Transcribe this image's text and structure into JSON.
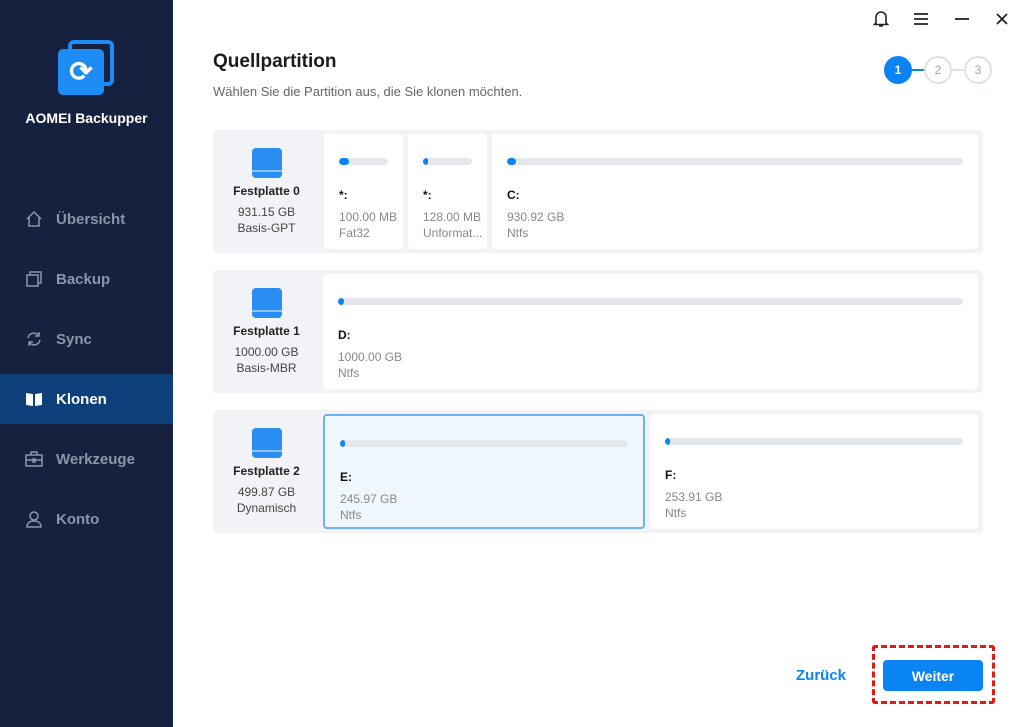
{
  "app": {
    "name": "AOMEI Backupper"
  },
  "nav": [
    {
      "label": "Übersicht",
      "icon": "home-icon"
    },
    {
      "label": "Backup",
      "icon": "backup-icon"
    },
    {
      "label": "Sync",
      "icon": "sync-icon"
    },
    {
      "label": "Klonen",
      "icon": "clone-icon",
      "active": true
    },
    {
      "label": "Werkzeuge",
      "icon": "toolbox-icon"
    },
    {
      "label": "Konto",
      "icon": "user-icon"
    }
  ],
  "page": {
    "title": "Quellpartition",
    "subtitle": "Wählen Sie die Partition aus, die Sie klonen möchten."
  },
  "steps": [
    "1",
    "2",
    "3"
  ],
  "disks": [
    {
      "name": "Festplatte 0",
      "size": "931.15 GB",
      "type": "Basis-GPT",
      "partitions": [
        {
          "label": "*:",
          "size": "100.00 MB",
          "fs": "Fat32",
          "used": 0.2
        },
        {
          "label": "*:",
          "size": "128.00 MB",
          "fs": "Unformat...",
          "used": 0.05
        },
        {
          "label": "C:",
          "size": "930.92 GB",
          "fs": "Ntfs",
          "used": 0.02
        }
      ]
    },
    {
      "name": "Festplatte 1",
      "size": "1000.00 GB",
      "type": "Basis-MBR",
      "partitions": [
        {
          "label": "D:",
          "size": "1000.00 GB",
          "fs": "Ntfs",
          "used": 0.01
        }
      ]
    },
    {
      "name": "Festplatte 2",
      "size": "499.87 GB",
      "type": "Dynamisch",
      "partitions": [
        {
          "label": "E:",
          "size": "245.97 GB",
          "fs": "Ntfs",
          "used": 0.01,
          "selected": true
        },
        {
          "label": "F:",
          "size": "253.91 GB",
          "fs": "Ntfs",
          "used": 0.01
        }
      ]
    }
  ],
  "buttons": {
    "back": "Zurück",
    "next": "Weiter"
  },
  "colors": {
    "accent": "#0a84f5",
    "sidebar": "#15213f",
    "highlight": "#e01818"
  }
}
